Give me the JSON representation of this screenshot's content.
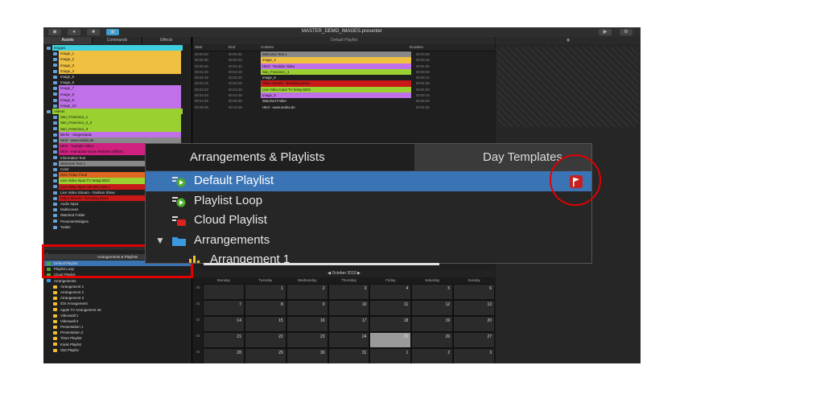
{
  "window": {
    "title": "MASTER_DEMO_IMAGES.presenter"
  },
  "left_tabs": [
    "Assets",
    "Commands",
    "Effects"
  ],
  "assets": [
    {
      "label": "Images",
      "color": "#3fd0e0"
    },
    {
      "label": "Image_1",
      "color": "#f0c040"
    },
    {
      "label": "Image_2",
      "color": "#f0c040"
    },
    {
      "label": "Image_3",
      "color": "#f0c040"
    },
    {
      "label": "Image_4",
      "color": "#f0c040"
    },
    {
      "label": "Image_5",
      "color": ""
    },
    {
      "label": "Image_6",
      "color": ""
    },
    {
      "label": "Image_7",
      "color": "#c070e8"
    },
    {
      "label": "Image_8",
      "color": "#c070e8"
    },
    {
      "label": "Image_9",
      "color": "#c070e8"
    },
    {
      "label": "Image_10",
      "color": "#c070e8"
    },
    {
      "label": "Videos",
      "color": "#9ad030"
    },
    {
      "label": "San_Francisco_1",
      "color": "#9ad030"
    },
    {
      "label": "San_Francisco_2_3",
      "color": "#9ad030"
    },
    {
      "label": "San_Francisco_3",
      "color": "#9ad030"
    },
    {
      "label": "Berlin - Siegessäule",
      "color": "#c070e8"
    },
    {
      "label": "Html - www.sedira.de",
      "color": "#888888"
    },
    {
      "label": "Html - Youtube Video",
      "color": "#d02080"
    },
    {
      "label": "Html - Interactive Kiosk Website (offline)",
      "color": "#d02080"
    },
    {
      "label": "Information Text",
      "color": ""
    },
    {
      "label": "Welcome Text 1",
      "color": "#888888"
    },
    {
      "label": "Color",
      "color": ""
    },
    {
      "label": "RSS Ticker Feed",
      "color": "#e06820"
    },
    {
      "label": "Live Video Input TV Setup BOX",
      "color": "#9ad030"
    },
    {
      "label": "Live Video Input HD-SDI Cam 1",
      "color": "#c81818"
    },
    {
      "label": "Live Video Stream - Fashion Show",
      "color": ""
    },
    {
      "label": "Video Stream - Breaking News",
      "color": "#c81818"
    },
    {
      "label": "Audio Input",
      "color": ""
    },
    {
      "label": "Multiscreen",
      "color": ""
    },
    {
      "label": "Watched Folder",
      "color": ""
    },
    {
      "label": "PresenterWidgets",
      "color": ""
    },
    {
      "label": "Twitter",
      "color": ""
    }
  ],
  "playlists_section": {
    "header": "Arrangements & Playlists",
    "items": [
      "Default Playlist",
      "Playlist Loop",
      "Cloud Playlist",
      "Arrangements",
      "Arrangement 1",
      "Arrangement 2",
      "Arrangement 3",
      "iOS Arrangement",
      "Apple TV Arrangement 4K",
      "Videowall 1",
      "Videowall 2",
      "Presentation 1",
      "Presentation 2",
      "Timer Playlist",
      "Kiosk Playlist",
      "Slot Playlist"
    ]
  },
  "playlist": {
    "header": "Default Playlist",
    "columns": [
      "Start",
      "End",
      "Content",
      "Duration"
    ],
    "rows": [
      {
        "start": "00:00:00",
        "end": "00:00:30",
        "content": "Welcome Text 1",
        "duration": "00:00:30",
        "color": "#888888"
      },
      {
        "start": "00:00:30",
        "end": "00:00:40",
        "content": "Image_4",
        "duration": "00:00:10",
        "color": "#f0c040"
      },
      {
        "start": "00:00:40",
        "end": "00:01:40",
        "content": "Html - Youtube Video",
        "duration": "00:01:00",
        "color": "#c070e8"
      },
      {
        "start": "00:01:40",
        "end": "00:02:19",
        "content": "San_Francisco_1",
        "duration": "00:00:39",
        "color": "#9ad030"
      },
      {
        "start": "00:02:19",
        "end": "00:02:29",
        "content": "Image_6",
        "duration": "00:00:10",
        "color": ""
      },
      {
        "start": "00:02:29",
        "end": "00:03:29",
        "content": "Video Stream - Breaking News",
        "duration": "00:01:00",
        "color": "#c81818"
      },
      {
        "start": "00:03:29",
        "end": "00:04:29",
        "content": "Live Video Input TV Setup BOX",
        "duration": "00:01:00",
        "color": "#9ad030"
      },
      {
        "start": "00:04:29",
        "end": "00:04:39",
        "content": "Image_8",
        "duration": "00:00:10",
        "color": "#c070e8"
      },
      {
        "start": "00:04:39",
        "end": "00:09:39",
        "content": "Watched Folder",
        "duration": "00:05:00",
        "color": ""
      },
      {
        "start": "00:09:39",
        "end": "00:10:39",
        "content": "Html - www.sedira.de",
        "duration": "00:01:00",
        "color": ""
      }
    ]
  },
  "calendar": {
    "month": "October 2019",
    "days": [
      "Monday",
      "Tuesday",
      "Wednesday",
      "Thursday",
      "Friday",
      "Saturday",
      "Sunday"
    ],
    "weeks": [
      {
        "wk": "40",
        "dates": [
          "",
          "1",
          "2",
          "3",
          "4",
          "5",
          "6"
        ]
      },
      {
        "wk": "41",
        "dates": [
          "7",
          "8",
          "9",
          "10",
          "11",
          "12",
          "13"
        ]
      },
      {
        "wk": "42",
        "dates": [
          "14",
          "15",
          "16",
          "17",
          "18",
          "19",
          "20"
        ]
      },
      {
        "wk": "43",
        "dates": [
          "21",
          "22",
          "23",
          "24",
          "25",
          "26",
          "27"
        ]
      },
      {
        "wk": "44",
        "dates": [
          "28",
          "29",
          "30",
          "31",
          "1",
          "2",
          "3"
        ]
      }
    ]
  },
  "zoom": {
    "tab_active": "Arrangements & Playlists",
    "tab_inactive": "Day Templates",
    "rows": [
      "Default Playlist",
      "Playlist Loop",
      "Cloud Playlist",
      "Arrangements",
      "Arrangement 1"
    ]
  }
}
